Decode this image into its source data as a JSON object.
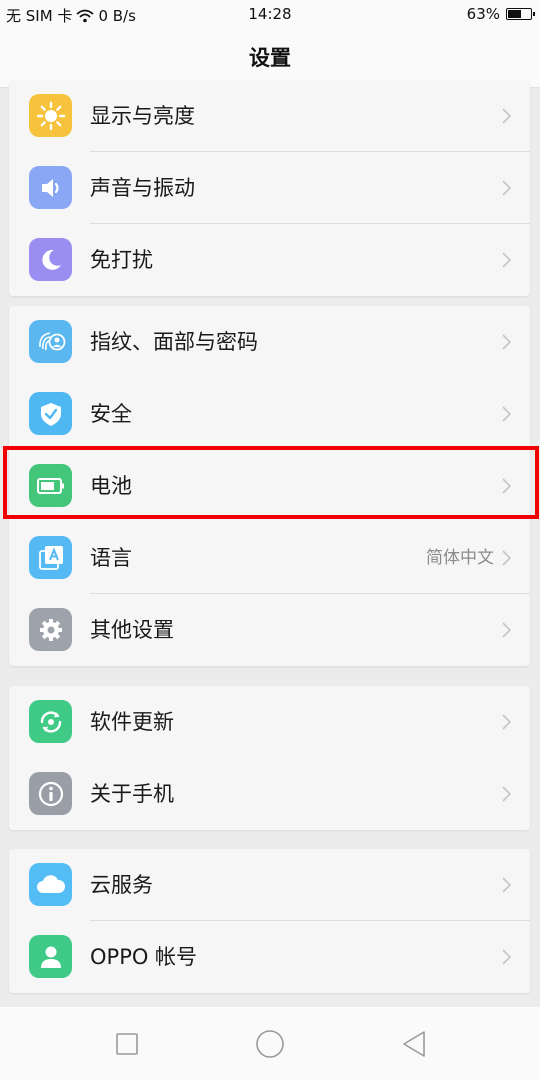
{
  "status_bar": {
    "carrier": "无 SIM 卡",
    "network_speed": "0 B/s",
    "time": "14:28",
    "battery_percent": "63%",
    "battery_level": 0.63
  },
  "header": {
    "title": "设置"
  },
  "groups": [
    {
      "items": [
        {
          "name": "display",
          "label": "显示与亮度",
          "icon": "brightness-icon",
          "color": "#f8c33c"
        },
        {
          "name": "sound",
          "label": "声音与振动",
          "icon": "speaker-icon",
          "color": "#8aa7f6"
        },
        {
          "name": "dnd",
          "label": "免打扰",
          "icon": "moon-icon",
          "color": "#9b8ef2"
        }
      ]
    },
    {
      "items": [
        {
          "name": "fingerprint",
          "label": "指纹、面部与密码",
          "icon": "fingerprint-face-icon",
          "color": "#5ab7f0"
        },
        {
          "name": "security",
          "label": "安全",
          "icon": "shield-check-icon",
          "color": "#4fb8f2"
        },
        {
          "name": "battery",
          "label": "电池",
          "icon": "battery-icon",
          "color": "#43c57a"
        },
        {
          "name": "language",
          "label": "语言",
          "icon": "language-icon",
          "color": "#55b9f4",
          "value": "简体中文"
        },
        {
          "name": "other",
          "label": "其他设置",
          "icon": "gear-icon",
          "color": "#9ea3ab"
        }
      ]
    },
    {
      "items": [
        {
          "name": "update",
          "label": "软件更新",
          "icon": "refresh-icon",
          "color": "#3fca86"
        },
        {
          "name": "about",
          "label": "关于手机",
          "icon": "info-icon",
          "color": "#9a9ea6"
        }
      ]
    },
    {
      "items": [
        {
          "name": "cloud",
          "label": "云服务",
          "icon": "cloud-icon",
          "color": "#55bdf6"
        },
        {
          "name": "account",
          "label": "OPPO 帐号",
          "icon": "person-icon",
          "color": "#3fcb87"
        }
      ]
    }
  ],
  "nav_bar": {
    "buttons": [
      "recent-apps",
      "home",
      "back"
    ]
  }
}
